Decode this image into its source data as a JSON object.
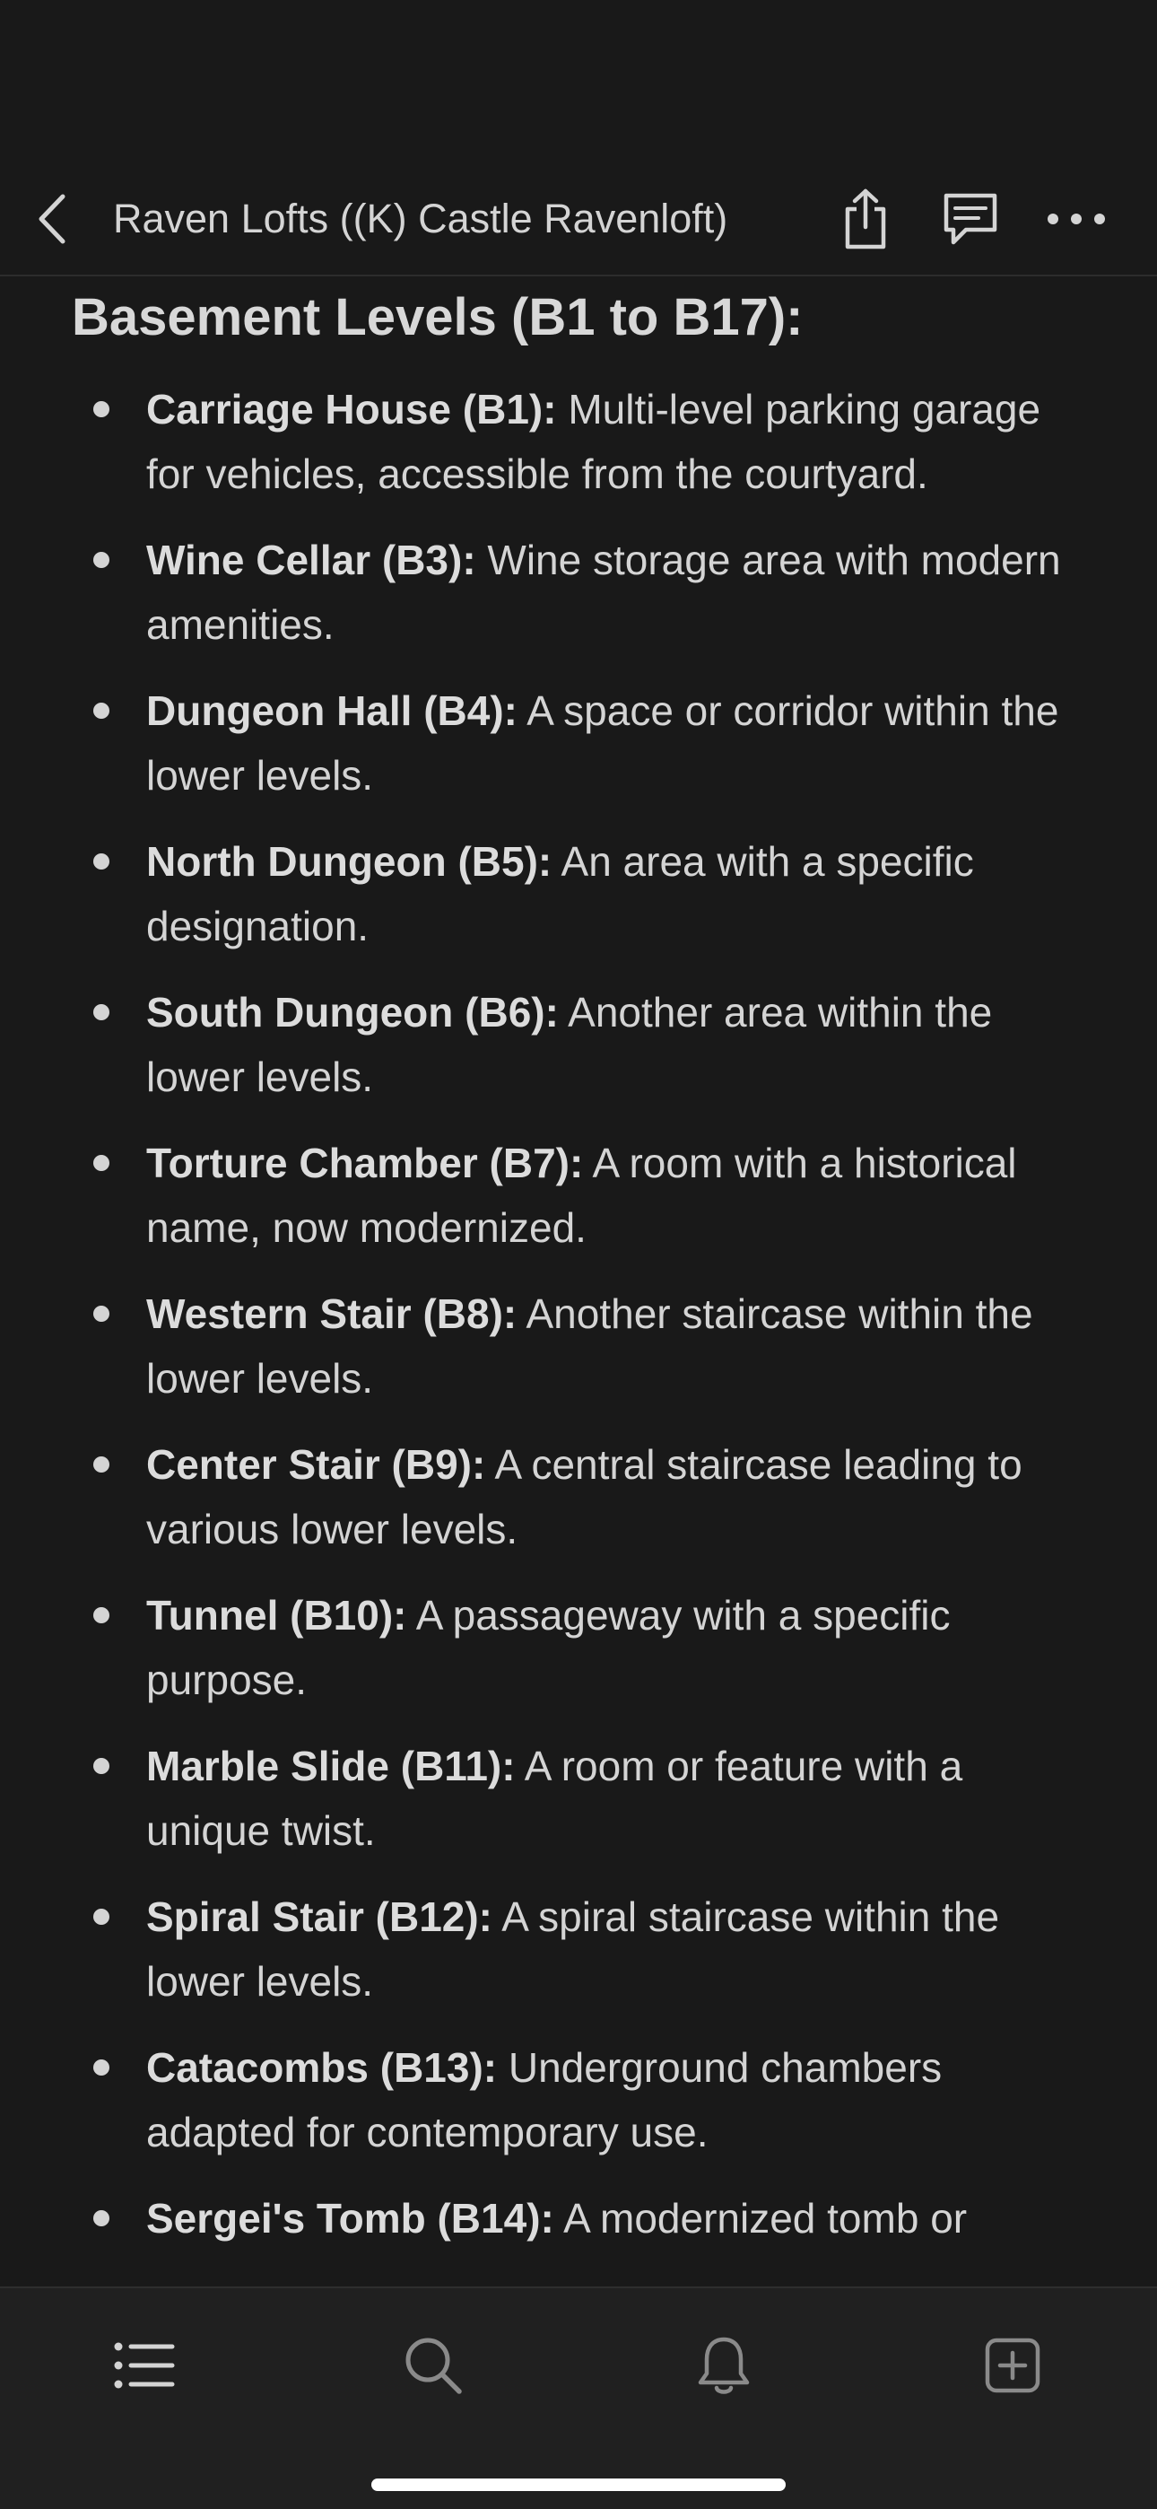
{
  "header": {
    "title": "Raven Lofts ((K) Castle Ravenloft)",
    "back_icon": "chevron-left-icon",
    "actions": [
      "share-icon",
      "comment-icon",
      "more-icon"
    ]
  },
  "document": {
    "heading": "Basement Levels (B1 to B17):",
    "items": [
      {
        "term": "Carriage House (B1):",
        "desc": " Multi-level parking garage for vehicles, accessible from the courtyard."
      },
      {
        "term": "Wine Cellar (B3):",
        "desc": " Wine storage area with modern amenities."
      },
      {
        "term": "Dungeon Hall (B4):",
        "desc": " A space or corridor within the lower levels."
      },
      {
        "term": "North Dungeon (B5):",
        "desc": " An area with a specific designation."
      },
      {
        "term": "South Dungeon (B6):",
        "desc": " Another area within the lower levels."
      },
      {
        "term": "Torture Chamber (B7):",
        "desc": " A room with a historical name, now modernized."
      },
      {
        "term": "Western Stair (B8):",
        "desc": " Another staircase within the lower levels."
      },
      {
        "term": "Center Stair (B9):",
        "desc": " A central staircase leading to various lower levels."
      },
      {
        "term": "Tunnel (B10):",
        "desc": " A passageway with a specific purpose."
      },
      {
        "term": "Marble Slide (B11):",
        "desc": " A room or feature with a unique twist."
      },
      {
        "term": "Spiral Stair (B12):",
        "desc": " A spiral staircase within the lower levels."
      },
      {
        "term": "Catacombs (B13):",
        "desc": " Underground chambers adapted for contemporary use."
      },
      {
        "term": "Sergei's Tomb (B14):",
        "desc": " A modernized tomb or"
      }
    ]
  },
  "tabbar": {
    "tabs": [
      "list-icon",
      "search-icon",
      "bell-icon",
      "new-page-icon"
    ]
  },
  "colors": {
    "background": "#191919",
    "text": "#d4d4d4",
    "tabbar": "#202020"
  }
}
